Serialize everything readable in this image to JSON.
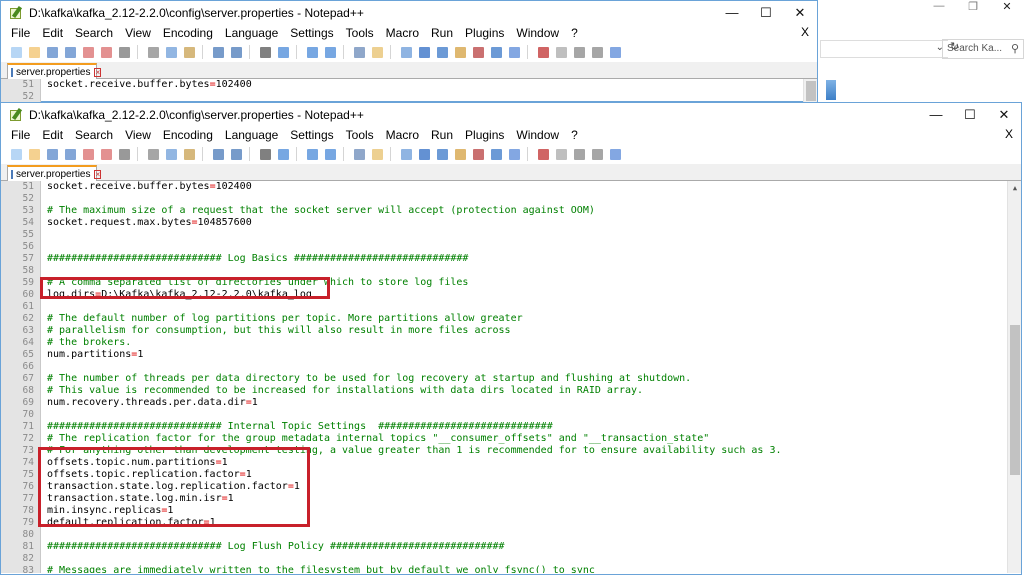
{
  "background_explorer": {
    "search_placeholder": "Search Ka..."
  },
  "window1": {
    "title": "D:\\kafka\\kafka_2.12-2.2.0\\config\\server.properties - Notepad++",
    "menu": [
      "File",
      "Edit",
      "Search",
      "View",
      "Encoding",
      "Language",
      "Settings",
      "Tools",
      "Macro",
      "Run",
      "Plugins",
      "Window",
      "?"
    ],
    "close_doc": "X",
    "tab_label": "server.properties",
    "lines": [
      {
        "n": "51",
        "text": "socket.receive.buffer.bytes=102400",
        "kind": "kv"
      },
      {
        "n": "52",
        "text": "",
        "kind": "blank"
      }
    ]
  },
  "window2": {
    "title": "D:\\kafka\\kafka_2.12-2.2.0\\config\\server.properties - Notepad++",
    "menu": [
      "File",
      "Edit",
      "Search",
      "View",
      "Encoding",
      "Language",
      "Settings",
      "Tools",
      "Macro",
      "Run",
      "Plugins",
      "Window",
      "?"
    ],
    "close_doc": "X",
    "tab_label": "server.properties",
    "lines": [
      {
        "n": "51",
        "text": "socket.receive.buffer.bytes=102400",
        "kind": "kv"
      },
      {
        "n": "52",
        "text": "",
        "kind": "blank"
      },
      {
        "n": "53",
        "text": "# The maximum size of a request that the socket server will accept (protection against OOM)",
        "kind": "comment"
      },
      {
        "n": "54",
        "text": "socket.request.max.bytes=104857600",
        "kind": "kv"
      },
      {
        "n": "55",
        "text": "",
        "kind": "blank"
      },
      {
        "n": "56",
        "text": "",
        "kind": "blank"
      },
      {
        "n": "57",
        "text": "############################# Log Basics #############################",
        "kind": "comment"
      },
      {
        "n": "58",
        "text": "",
        "kind": "blank"
      },
      {
        "n": "59",
        "text": "# A comma separated list of directories under which to store log files",
        "kind": "comment"
      },
      {
        "n": "60",
        "text": "log.dirs=D:\\Kafka\\kafka_2.12-2.2.0\\kafka_log",
        "kind": "kv"
      },
      {
        "n": "61",
        "text": "",
        "kind": "blank"
      },
      {
        "n": "62",
        "text": "# The default number of log partitions per topic. More partitions allow greater",
        "kind": "comment"
      },
      {
        "n": "63",
        "text": "# parallelism for consumption, but this will also result in more files across",
        "kind": "comment"
      },
      {
        "n": "64",
        "text": "# the brokers.",
        "kind": "comment"
      },
      {
        "n": "65",
        "text": "num.partitions=1",
        "kind": "kv"
      },
      {
        "n": "66",
        "text": "",
        "kind": "blank"
      },
      {
        "n": "67",
        "text": "# The number of threads per data directory to be used for log recovery at startup and flushing at shutdown.",
        "kind": "comment"
      },
      {
        "n": "68",
        "text": "# This value is recommended to be increased for installations with data dirs located in RAID array.",
        "kind": "comment"
      },
      {
        "n": "69",
        "text": "num.recovery.threads.per.data.dir=1",
        "kind": "kv"
      },
      {
        "n": "70",
        "text": "",
        "kind": "blank"
      },
      {
        "n": "71",
        "text": "############################# Internal Topic Settings  #############################",
        "kind": "comment"
      },
      {
        "n": "72",
        "text": "# The replication factor for the group metadata internal topics \"__consumer_offsets\" and \"__transaction_state\"",
        "kind": "comment"
      },
      {
        "n": "73",
        "text": "# For anything other than development testing, a value greater than 1 is recommended for to ensure availability such as 3.",
        "kind": "comment"
      },
      {
        "n": "74",
        "text": "offsets.topic.num.partitions=1",
        "kind": "kv"
      },
      {
        "n": "75",
        "text": "offsets.topic.replication.factor=1",
        "kind": "kv"
      },
      {
        "n": "76",
        "text": "transaction.state.log.replication.factor=1",
        "kind": "kv"
      },
      {
        "n": "77",
        "text": "transaction.state.log.min.isr=1",
        "kind": "kv"
      },
      {
        "n": "78",
        "text": "min.insync.replicas=1",
        "kind": "kv"
      },
      {
        "n": "79",
        "text": "default.replication.factor=1",
        "kind": "kv"
      },
      {
        "n": "80",
        "text": "",
        "kind": "blank"
      },
      {
        "n": "81",
        "text": "############################# Log Flush Policy #############################",
        "kind": "comment"
      },
      {
        "n": "82",
        "text": "",
        "kind": "blank"
      },
      {
        "n": "83",
        "text": "# Messages are immediately written to the filesystem but by default we only fsync() to sync",
        "kind": "comment"
      }
    ]
  },
  "colors": {
    "comment": "#008000",
    "equals": "#dd0000",
    "highlight_box": "#c8202a",
    "active_tab_accent": "#f39c1e"
  },
  "toolbar_icons": [
    "new-file-icon",
    "open-file-icon",
    "save-icon",
    "save-all-icon",
    "close-icon",
    "close-all-icon",
    "print-icon",
    "cut-icon",
    "copy-icon",
    "paste-icon",
    "undo-icon",
    "redo-icon",
    "find-icon",
    "replace-icon",
    "zoom-in-icon",
    "zoom-out-icon",
    "sync-vertical-icon",
    "sync-horizontal-icon",
    "word-wrap-icon",
    "show-all-chars-icon",
    "indent-guide-icon",
    "user-lang-icon",
    "doc-map-icon",
    "function-list-icon",
    "folder-workspace-icon",
    "monitor-icon",
    "record-macro-icon",
    "stop-record-icon",
    "play-macro-icon",
    "run-macro-multiple-icon",
    "save-macro-icon"
  ]
}
